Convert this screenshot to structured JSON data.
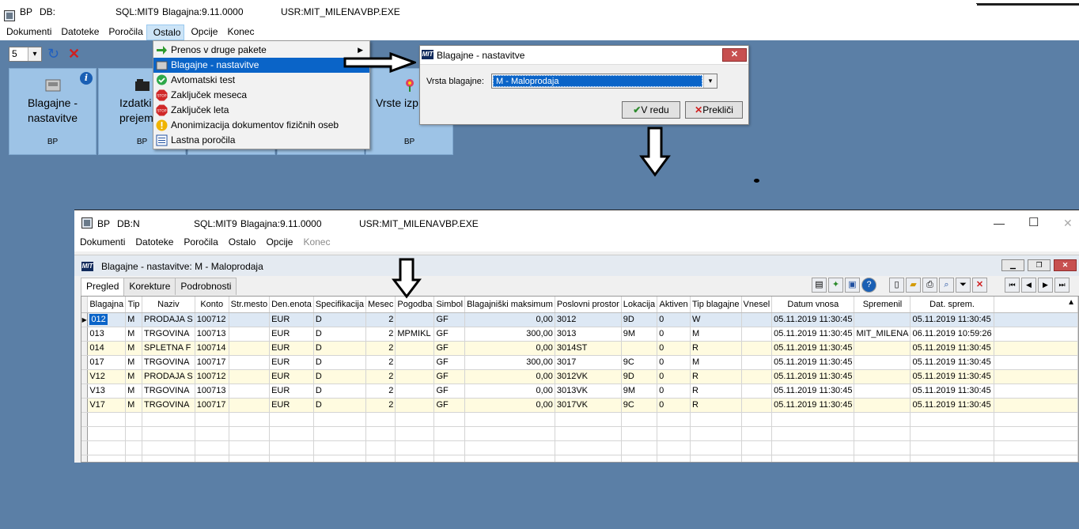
{
  "top_window": {
    "title": {
      "app": "BP",
      "db": "DB:",
      "sql": "SQL:MIT9",
      "version": "Blagajna:9.11.0000",
      "user": "USR:MIT_MILENA",
      "exe": "VBP.EXE"
    },
    "menu": [
      "Dokumenti",
      "Datoteke",
      "Poročila",
      "Ostalo",
      "Opcije",
      "Konec"
    ],
    "toolbar": {
      "select_value": "5"
    },
    "tiles": [
      {
        "name_line1": "Blagajne -",
        "name_line2": "nastavitve",
        "sub": "BP"
      },
      {
        "name_line1": "Izdatki",
        "name_line2": "prejem",
        "sub": "BP"
      },
      {
        "name_line1": "Vrste izp",
        "name_line2": "",
        "sub": "BP"
      }
    ]
  },
  "dropdown": {
    "items": [
      {
        "label": "Prenos v druge pakete",
        "icon": "green-arrow-icon"
      },
      {
        "label": "Blagajne - nastavitve",
        "icon": "register-icon"
      },
      {
        "label": "Avtomatski test",
        "icon": "chat-bubble-icon"
      },
      {
        "label": "Zaključek meseca",
        "icon": "stop-sign-icon"
      },
      {
        "label": "Zaključek leta",
        "icon": "stop-sign-icon"
      },
      {
        "label": "Anonimizacija dokumentov fizičnih oseb",
        "icon": "warning-icon"
      },
      {
        "label": "Lastna poročila",
        "icon": "list-icon"
      }
    ]
  },
  "dialog": {
    "title": "Blagajne - nastavitve",
    "logo": "MIT",
    "label": "Vrsta blagajne:",
    "value": "M - Maloprodaja",
    "ok": "V redu",
    "cancel": "Prekliči"
  },
  "win2": {
    "title": {
      "app": "BP",
      "db": "DB:N",
      "sql": "SQL:MIT9",
      "version": "Blagajna:9.11.0000",
      "user": "USR:MIT_MILENA",
      "exe": "VBP.EXE"
    },
    "menu": [
      "Dokumenti",
      "Datoteke",
      "Poročila",
      "Ostalo",
      "Opcije",
      "Konec"
    ],
    "subtitle": "Blagajne - nastavitve:  M - Maloprodaja",
    "tabs": [
      "Pregled",
      "Korekture",
      "Podrobnosti"
    ],
    "columns": [
      "Blagajna",
      "Tip",
      "Naziv",
      "Konto",
      "Str.mesto",
      "Den.enota",
      "Specifikacija",
      "Mesec",
      "Pogodba",
      "Simbol",
      "Blagajniški maksimum",
      "Poslovni prostor",
      "Lokacija",
      "Aktiven",
      "Tip blagajne",
      "Vnesel",
      "Datum vnosa",
      "Spremenil",
      "Dat. sprem."
    ],
    "rows": [
      [
        "012",
        "M",
        "PRODAJA S",
        "100712",
        "",
        "EUR",
        "D",
        "2",
        "",
        "GF",
        "0,00",
        "3012",
        "9D",
        "0",
        "W",
        "",
        "05.11.2019 11:30:45",
        "",
        "05.11.2019 11:30:45"
      ],
      [
        "013",
        "M",
        "TRGOVINA",
        "100713",
        "",
        "EUR",
        "D",
        "2",
        "MPMIKL",
        "GF",
        "300,00",
        "3013",
        "9M",
        "0",
        "M",
        "",
        "05.11.2019 11:30:45",
        "MIT_MILENA",
        "06.11.2019 10:59:26"
      ],
      [
        "014",
        "M",
        "SPLETNA F",
        "100714",
        "",
        "EUR",
        "D",
        "2",
        "",
        "GF",
        "0,00",
        "3014ST",
        "",
        "0",
        "R",
        "",
        "05.11.2019 11:30:45",
        "",
        "05.11.2019 11:30:45"
      ],
      [
        "017",
        "M",
        "TRGOVINA",
        "100717",
        "",
        "EUR",
        "D",
        "2",
        "",
        "GF",
        "300,00",
        "3017",
        "9C",
        "0",
        "M",
        "",
        "05.11.2019 11:30:45",
        "",
        "05.11.2019 11:30:45"
      ],
      [
        "V12",
        "M",
        "PRODAJA S",
        "100712",
        "",
        "EUR",
        "D",
        "2",
        "",
        "GF",
        "0,00",
        "3012VK",
        "9D",
        "0",
        "R",
        "",
        "05.11.2019 11:30:45",
        "",
        "05.11.2019 11:30:45"
      ],
      [
        "V13",
        "M",
        "TRGOVINA",
        "100713",
        "",
        "EUR",
        "D",
        "2",
        "",
        "GF",
        "0,00",
        "3013VK",
        "9M",
        "0",
        "R",
        "",
        "05.11.2019 11:30:45",
        "",
        "05.11.2019 11:30:45"
      ],
      [
        "V17",
        "M",
        "TRGOVINA",
        "100717",
        "",
        "EUR",
        "D",
        "2",
        "",
        "GF",
        "0,00",
        "3017VK",
        "9C",
        "0",
        "R",
        "",
        "05.11.2019 11:30:45",
        "",
        "05.11.2019 11:30:45"
      ]
    ]
  },
  "colors": {
    "desktop": "#5b7fa6",
    "tile": "#9dc3e6",
    "highlight": "#0a64c8",
    "row_alt": "#fffbe0"
  }
}
